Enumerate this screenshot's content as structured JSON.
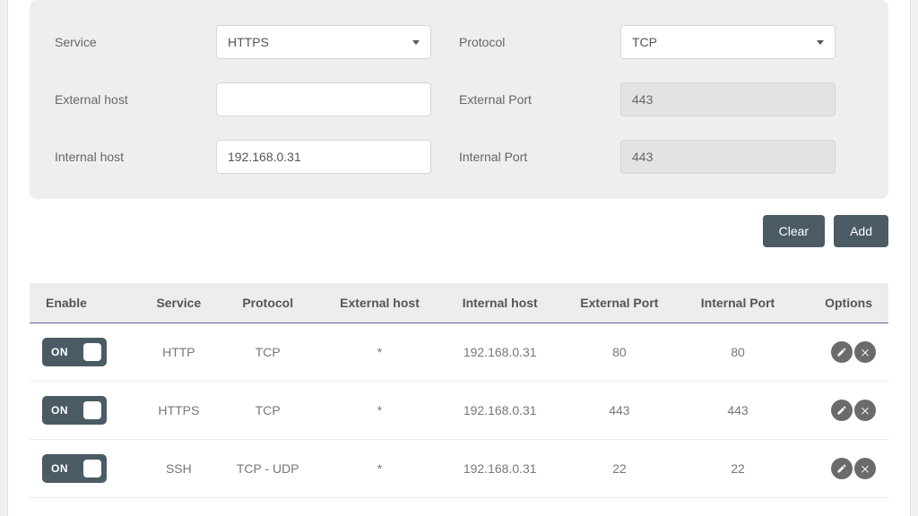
{
  "form": {
    "service_label": "Service",
    "service_value": "HTTPS",
    "protocol_label": "Protocol",
    "protocol_value": "TCP",
    "external_host_label": "External host",
    "external_host_value": "",
    "external_port_label": "External Port",
    "external_port_value": "443",
    "internal_host_label": "Internal host",
    "internal_host_value": "192.168.0.31",
    "internal_port_label": "Internal Port",
    "internal_port_value": "443"
  },
  "buttons": {
    "clear": "Clear",
    "add": "Add"
  },
  "table": {
    "headers": {
      "enable": "Enable",
      "service": "Service",
      "protocol": "Protocol",
      "external_host": "External host",
      "internal_host": "Internal host",
      "external_port": "External Port",
      "internal_port": "Internal Port",
      "options": "Options"
    },
    "toggle_on_label": "ON",
    "rows": [
      {
        "enable": true,
        "service": "HTTP",
        "protocol": "TCP",
        "external_host": "*",
        "internal_host": "192.168.0.31",
        "external_port": "80",
        "internal_port": "80"
      },
      {
        "enable": true,
        "service": "HTTPS",
        "protocol": "TCP",
        "external_host": "*",
        "internal_host": "192.168.0.31",
        "external_port": "443",
        "internal_port": "443"
      },
      {
        "enable": true,
        "service": "SSH",
        "protocol": "TCP - UDP",
        "external_host": "*",
        "internal_host": "192.168.0.31",
        "external_port": "22",
        "internal_port": "22"
      }
    ]
  }
}
